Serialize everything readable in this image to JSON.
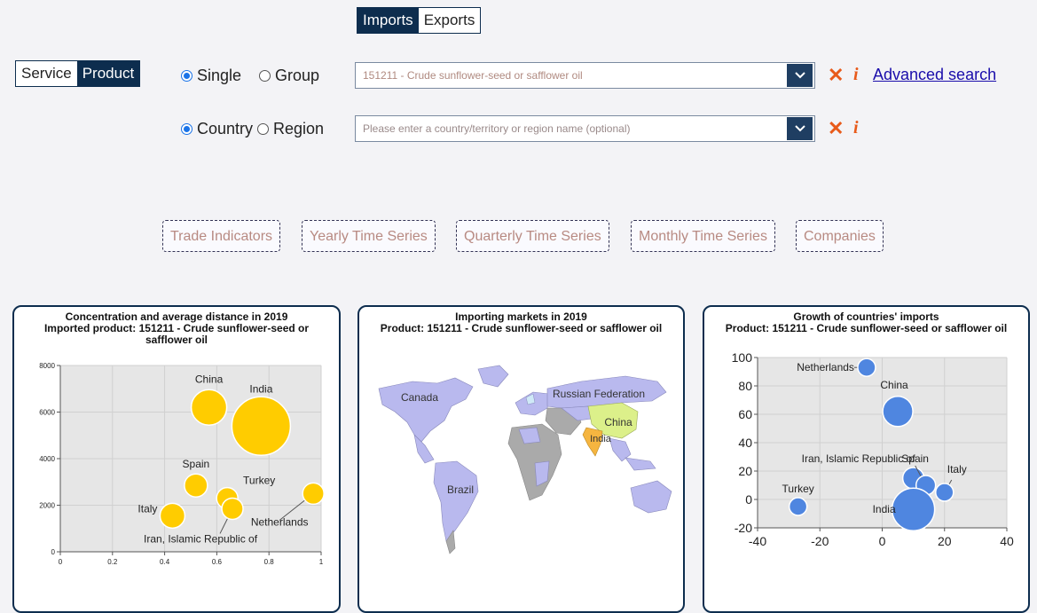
{
  "trade_toggle": {
    "imports": "Imports",
    "exports": "Exports",
    "active": "imports"
  },
  "type_toggle": {
    "service": "Service",
    "product": "Product",
    "active": "product"
  },
  "product_mode": {
    "single": "Single",
    "group": "Group",
    "selected": "single"
  },
  "partner_mode": {
    "country": "Country",
    "region": "Region",
    "selected": "country"
  },
  "product_select": {
    "value": "151211 - Crude sunflower-seed or safflower oil"
  },
  "country_select": {
    "placeholder": "Please enter a country/territory or region name (optional)"
  },
  "actions": {
    "clear_symbol": "✕",
    "info_symbol": "i",
    "advanced_search": "Advanced search"
  },
  "tabs": [
    "Trade Indicators",
    "Yearly Time Series",
    "Quarterly Time Series",
    "Monthly Time Series",
    "Companies"
  ],
  "colors": {
    "navy": "#0d2d4e",
    "bubble_gold": "#ffcc00",
    "bubble_blue": "#4f86e0",
    "accent_orange": "#e85a1a"
  },
  "panels": {
    "concentration": {
      "title": "Concentration and average distance in 2019",
      "subtitle": "Imported product: 151211 - Crude sunflower-seed or safflower oil"
    },
    "map": {
      "title": "Importing markets in 2019",
      "subtitle": "Product: 151211 - Crude sunflower-seed or safflower oil",
      "labels": [
        "Canada",
        "Russian Federation",
        "China",
        "India",
        "Brazil"
      ]
    },
    "growth": {
      "title": "Growth of countries' imports",
      "subtitle": "Product: 151211 - Crude sunflower-seed or safflower oil"
    }
  },
  "chart_data": [
    {
      "type": "scatter",
      "title": "Concentration and average distance in 2019",
      "xlim": [
        0,
        1
      ],
      "ylim": [
        0,
        8000
      ],
      "x_ticks": [
        "0",
        "0.2",
        "0.4",
        "0.6",
        "0.8",
        "1"
      ],
      "y_ticks": [
        "0",
        "2000",
        "4000",
        "6000",
        "8000"
      ],
      "grid": true,
      "points": [
        {
          "label": "China",
          "x": 0.57,
          "y": 6200,
          "size": 20
        },
        {
          "label": "India",
          "x": 0.77,
          "y": 5400,
          "size": 33
        },
        {
          "label": "Spain",
          "x": 0.52,
          "y": 2850,
          "size": 13
        },
        {
          "label": "Turkey",
          "x": 0.64,
          "y": 2300,
          "size": 12
        },
        {
          "label": "Netherlands",
          "x": 0.97,
          "y": 2500,
          "size": 12
        },
        {
          "label": "Italy",
          "x": 0.43,
          "y": 1550,
          "size": 14
        },
        {
          "label": "Iran, Islamic Republic of",
          "x": 0.66,
          "y": 1850,
          "size": 12
        }
      ]
    },
    {
      "type": "scatter",
      "title": "Growth of countries' imports",
      "xlim": [
        -40,
        40
      ],
      "ylim": [
        -20,
        100
      ],
      "x_ticks": [
        "-40",
        "-20",
        "0",
        "20",
        "40"
      ],
      "y_ticks": [
        "-20",
        "0",
        "20",
        "40",
        "60",
        "80",
        "100"
      ],
      "grid": true,
      "points": [
        {
          "label": "Netherlands",
          "x": -5,
          "y": 93,
          "size": 10
        },
        {
          "label": "China",
          "x": 5,
          "y": 62,
          "size": 17
        },
        {
          "label": "Spain",
          "x": 10,
          "y": 15,
          "size": 12
        },
        {
          "label": "Iran, Islamic Republic of",
          "x": 14,
          "y": 10,
          "size": 11
        },
        {
          "label": "Italy",
          "x": 20,
          "y": 5,
          "size": 10
        },
        {
          "label": "Turkey",
          "x": -27,
          "y": -5,
          "size": 10
        },
        {
          "label": "India",
          "x": 10,
          "y": -7,
          "size": 24
        }
      ]
    }
  ]
}
